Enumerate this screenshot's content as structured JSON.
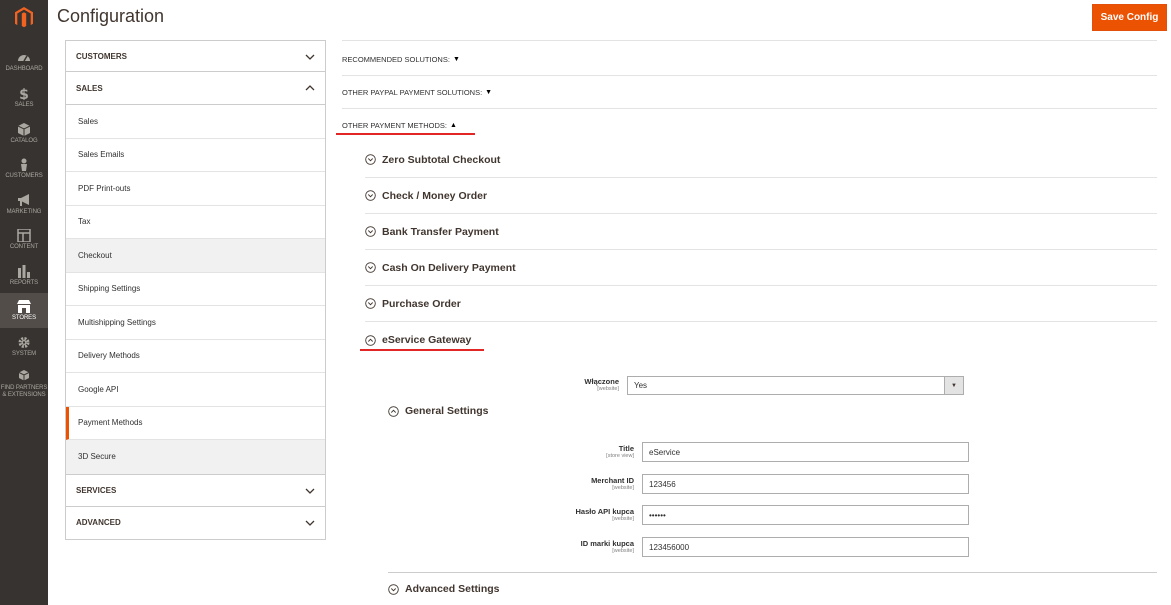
{
  "app": {
    "title": "Configuration",
    "save_label": "Save Config",
    "accent_color": "#eb5202"
  },
  "admin_nav": [
    {
      "label": "DASHBOARD",
      "icon": "dashboard-icon"
    },
    {
      "label": "SALES",
      "icon": "dollar-icon"
    },
    {
      "label": "CATALOG",
      "icon": "cube-icon"
    },
    {
      "label": "CUSTOMERS",
      "icon": "person-icon"
    },
    {
      "label": "MARKETING",
      "icon": "megaphone-icon"
    },
    {
      "label": "CONTENT",
      "icon": "layout-icon"
    },
    {
      "label": "REPORTS",
      "icon": "bar-chart-icon"
    },
    {
      "label": "STORES",
      "icon": "store-icon"
    },
    {
      "label": "SYSTEM",
      "icon": "gear-icon"
    },
    {
      "label": "FIND PARTNERS & EXTENSIONS",
      "icon": "cubes-icon"
    }
  ],
  "tabs": {
    "customers": "CUSTOMERS",
    "sales": "SALES",
    "sales_items": [
      "Sales",
      "Sales Emails",
      "PDF Print-outs",
      "Tax",
      "Checkout",
      "Shipping Settings",
      "Multishipping Settings",
      "Delivery Methods",
      "Google API",
      "Payment Methods",
      "3D Secure"
    ],
    "services": "SERVICES",
    "advanced": "ADVANCED"
  },
  "sections": {
    "recommended": "RECOMMENDED SOLUTIONS:",
    "other_paypal": "OTHER PAYPAL PAYMENT SOLUTIONS:",
    "other_methods": "OTHER PAYMENT METHODS:"
  },
  "methods": [
    "Zero Subtotal Checkout",
    "Check / Money Order",
    "Bank Transfer Payment",
    "Cash On Delivery Payment",
    "Purchase Order"
  ],
  "eservice": {
    "title": "eService Gateway",
    "enabled_label": "Włączone",
    "enabled_scope": "[website]",
    "enabled_value": "Yes",
    "general_settings": "General Settings",
    "fields": [
      {
        "label": "Title",
        "scope": "[store view]",
        "value": "eService"
      },
      {
        "label": "Merchant ID",
        "scope": "[website]",
        "value": "123456"
      },
      {
        "label": "Hasło API kupca",
        "scope": "[website]",
        "value": "••••••"
      },
      {
        "label": "ID marki kupca",
        "scope": "[website]",
        "value": "123456000"
      }
    ],
    "advanced_settings": "Advanced Settings"
  }
}
